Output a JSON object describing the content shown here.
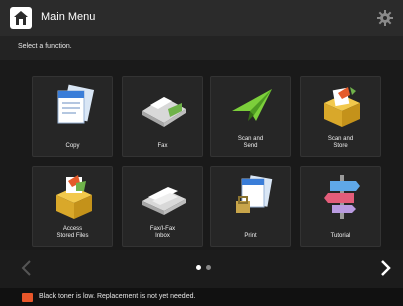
{
  "header": {
    "title": "Main Menu"
  },
  "prompt": "Select a function.",
  "tiles": [
    {
      "label": "Copy",
      "icon": "copy-icon"
    },
    {
      "label": "Fax",
      "icon": "fax-icon"
    },
    {
      "label": "Scan and\nSend",
      "icon": "scan-send-icon"
    },
    {
      "label": "Scan and\nStore",
      "icon": "scan-store-icon"
    },
    {
      "label": "Access\nStored Files",
      "icon": "stored-files-icon"
    },
    {
      "label": "Fax/I-Fax\nInbox",
      "icon": "fax-inbox-icon"
    },
    {
      "label": "Print",
      "icon": "print-icon"
    },
    {
      "label": "Tutorial",
      "icon": "tutorial-icon"
    }
  ],
  "pagination": {
    "pages": 2,
    "current": 1
  },
  "status": {
    "message": "Black toner is low. Replacement is not yet needed."
  },
  "colors": {
    "accent": "#e8562a",
    "header": "#2b2b2b",
    "background": "#1a1a1a"
  }
}
